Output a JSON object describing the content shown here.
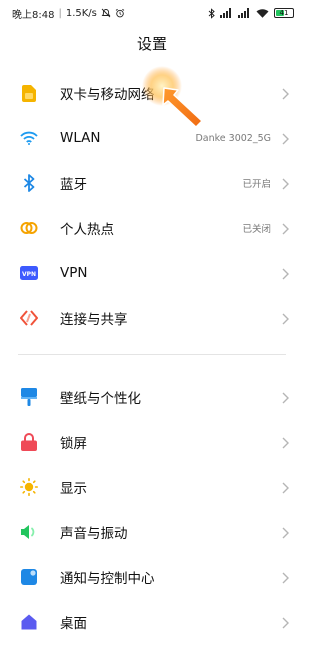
{
  "status_bar": {
    "time": "晚上8:48",
    "speed": "1.5K/s",
    "battery": "41",
    "icons": [
      "mute-icon",
      "alarm-icon",
      "bluetooth-icon",
      "signal-icon",
      "signal-icon",
      "wifi-icon",
      "battery-icon"
    ]
  },
  "page": {
    "title": "设置"
  },
  "section1": [
    {
      "label": "双卡与移动网络",
      "value": "",
      "icon": "sim-card-icon",
      "color": "#f5b400"
    },
    {
      "label": "WLAN",
      "value": "Danke 3002_5G",
      "icon": "wifi-icon",
      "color": "#1e9bf0"
    },
    {
      "label": "蓝牙",
      "value": "已开启",
      "icon": "bluetooth-icon",
      "color": "#1e88e5"
    },
    {
      "label": "个人热点",
      "value": "已关闭",
      "icon": "hotspot-icon",
      "color": "#f5a300"
    },
    {
      "label": "VPN",
      "value": "",
      "icon": "vpn-icon",
      "color": "#3d5afe"
    },
    {
      "label": "连接与共享",
      "value": "",
      "icon": "share-icon",
      "color": "#f0533a"
    }
  ],
  "section2": [
    {
      "label": "壁纸与个性化",
      "value": "",
      "icon": "wallpaper-icon",
      "color": "#1e88e5"
    },
    {
      "label": "锁屏",
      "value": "",
      "icon": "lock-icon",
      "color": "#ef4a57"
    },
    {
      "label": "显示",
      "value": "",
      "icon": "brightness-icon",
      "color": "#f5b400"
    },
    {
      "label": "声音与振动",
      "value": "",
      "icon": "sound-icon",
      "color": "#22c55e"
    },
    {
      "label": "通知与控制中心",
      "value": "",
      "icon": "notification-icon",
      "color": "#1e88e5"
    },
    {
      "label": "桌面",
      "value": "",
      "icon": "home-icon",
      "color": "#5b5bf0"
    }
  ]
}
